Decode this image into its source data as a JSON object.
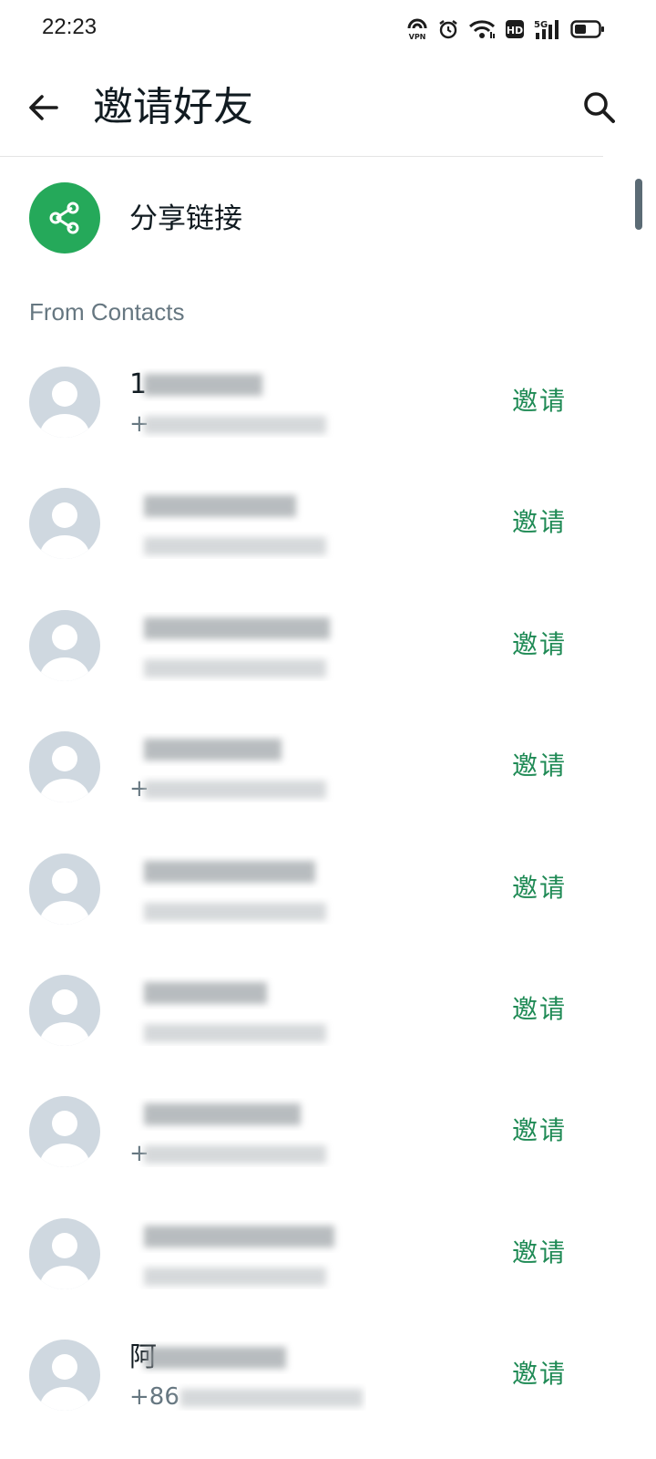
{
  "status_bar": {
    "time": "22:23",
    "icons": [
      "vpn-icon",
      "alarm-icon",
      "wifi-icon",
      "hd-icon",
      "signal-5g-icon",
      "battery-icon"
    ],
    "vpn_text": "VPN",
    "hd_text": "HD",
    "net_text": "5G"
  },
  "app_bar": {
    "title": "邀请好友",
    "back_icon": "arrow-left-icon",
    "search_icon": "search-icon"
  },
  "share": {
    "label": "分享链接",
    "icon": "share-icon",
    "color": "#25a95a"
  },
  "section": {
    "title": "From Contacts"
  },
  "invite_color": "#1f8a55",
  "contacts": [
    {
      "name": "1",
      "phone": "+",
      "invite_label": "邀请"
    },
    {
      "name": "",
      "phone": "",
      "invite_label": "邀请"
    },
    {
      "name": "",
      "phone": "",
      "invite_label": "邀请"
    },
    {
      "name": "",
      "phone": "+",
      "invite_label": "邀请"
    },
    {
      "name": "",
      "phone": "",
      "invite_label": "邀请"
    },
    {
      "name": "",
      "phone": "",
      "invite_label": "邀请"
    },
    {
      "name": "",
      "phone": "+",
      "invite_label": "邀请"
    },
    {
      "name": "",
      "phone": "",
      "invite_label": "邀请"
    },
    {
      "name": "阿",
      "phone": "+86",
      "invite_label": "邀请"
    }
  ]
}
